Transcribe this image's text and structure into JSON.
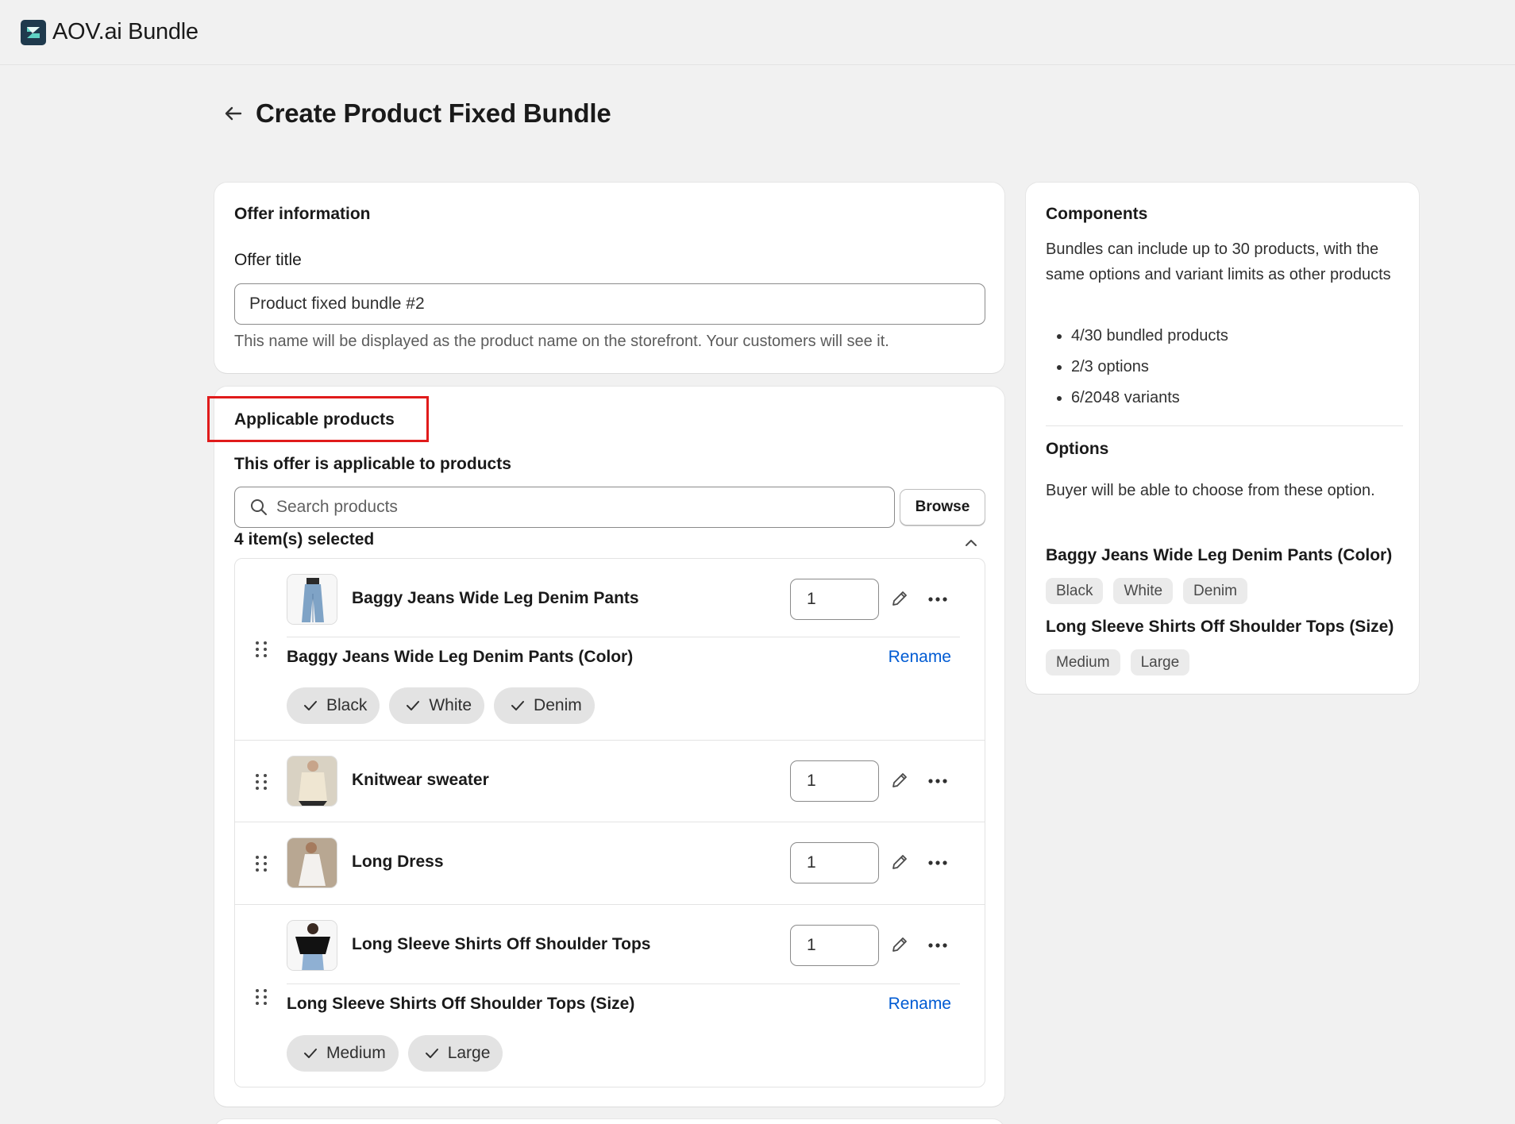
{
  "app": {
    "name": "AOV.ai Bundle"
  },
  "page": {
    "title": "Create Product Fixed Bundle"
  },
  "offer": {
    "heading": "Offer information",
    "title_label": "Offer title",
    "title_value": "Product fixed bundle #2",
    "help": "This name will be displayed as the product name on the storefront. Your customers will see it."
  },
  "products": {
    "heading": "Applicable products",
    "subheading": "This offer is applicable to products",
    "search_placeholder": "Search products",
    "browse_label": "Browse",
    "selected_count": "4 item(s) selected",
    "items": [
      {
        "name": "Baggy Jeans Wide Leg Denim Pants",
        "qty": "1",
        "option_title": "Baggy Jeans Wide Leg Denim Pants (Color)",
        "rename": "Rename",
        "values": [
          "Black",
          "White",
          "Denim"
        ]
      },
      {
        "name": "Knitwear sweater",
        "qty": "1"
      },
      {
        "name": "Long Dress",
        "qty": "1"
      },
      {
        "name": "Long Sleeve Shirts Off Shoulder Tops",
        "qty": "1",
        "option_title": "Long Sleeve Shirts Off Shoulder Tops (Size)",
        "rename": "Rename",
        "values": [
          "Medium",
          "Large"
        ]
      }
    ]
  },
  "components": {
    "heading": "Components",
    "description": "Bundles can include up to 30 products, with the same options and variant limits as other products",
    "limits": [
      "4/30 bundled products",
      "2/3 options",
      "6/2048 variants"
    ],
    "options_heading": "Options",
    "options_description": "Buyer will be able to choose from these option.",
    "option_groups": [
      {
        "title": "Baggy Jeans Wide Leg Denim Pants (Color)",
        "values": [
          "Black",
          "White",
          "Denim"
        ]
      },
      {
        "title": "Long Sleeve Shirts Off Shoulder Tops (Size)",
        "values": [
          "Medium",
          "Large"
        ]
      }
    ]
  },
  "colors": {
    "accent_link": "#005bd3",
    "highlight": "#e01b1b",
    "background": "#f1f1f1"
  }
}
